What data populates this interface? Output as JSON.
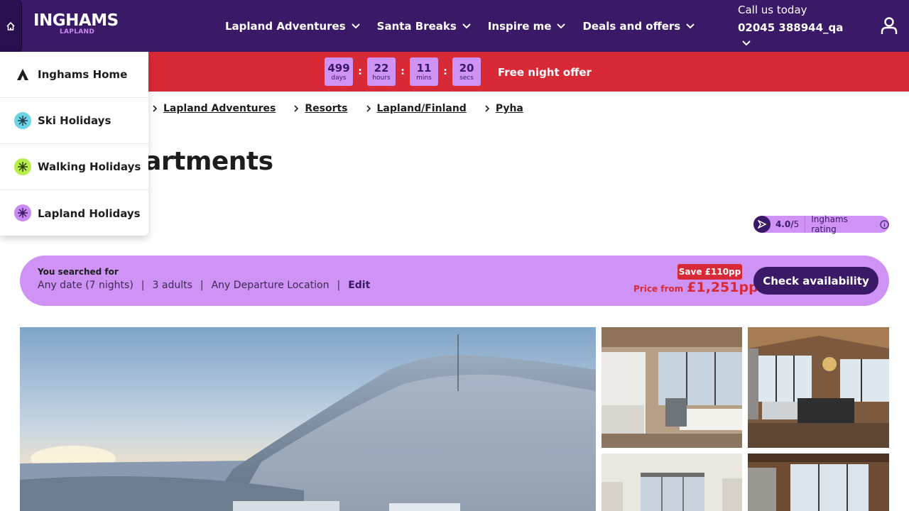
{
  "header": {
    "logo_main": "INGHAMS",
    "logo_sub": "LAPLAND",
    "nav": [
      {
        "label": "Lapland Adventures"
      },
      {
        "label": "Santa Breaks"
      },
      {
        "label": "Inspire me"
      },
      {
        "label": "Deals and offers"
      }
    ],
    "call_label": "Call us today",
    "call_phone": "02045 388944_qa",
    "icons": [
      "home-icon",
      "chevron-down-icon",
      "account-icon"
    ]
  },
  "promo": {
    "timer": [
      {
        "value": "499",
        "unit": "days"
      },
      {
        "value": "22",
        "unit": "hours"
      },
      {
        "value": "11",
        "unit": "mins"
      },
      {
        "value": "20",
        "unit": "secs"
      }
    ],
    "separator": ":",
    "text": "Free night offer"
  },
  "breadcrumb": [
    "Lapland Adventures",
    "Resorts",
    "Lapland/Finland",
    "Pyha"
  ],
  "page_title": "artments",
  "rating": {
    "score": "4.0/",
    "out_of": "5",
    "label": "Inghams rating"
  },
  "search": {
    "title": "You searched for",
    "date": "Any date (7 nights)",
    "adults": "3 adults",
    "departure": "Any Departure Location",
    "edit": "Edit",
    "save_badge": "Save £110pp",
    "price_from": "Price from",
    "price": "£1,251pp",
    "cta": "Check availability"
  },
  "dropdown": [
    {
      "label": "Inghams Home",
      "icon": "inghams-logo-icon"
    },
    {
      "label": "Ski Holidays",
      "icon": "snowflake-icon"
    },
    {
      "label": "Walking Holidays",
      "icon": "snowflake-icon"
    },
    {
      "label": "Lapland Holidays",
      "icon": "snowflake-icon"
    }
  ],
  "colors": {
    "brand_purple": "#3a1a66",
    "lilac": "#cf93f5",
    "promo_red": "#d82a36"
  }
}
